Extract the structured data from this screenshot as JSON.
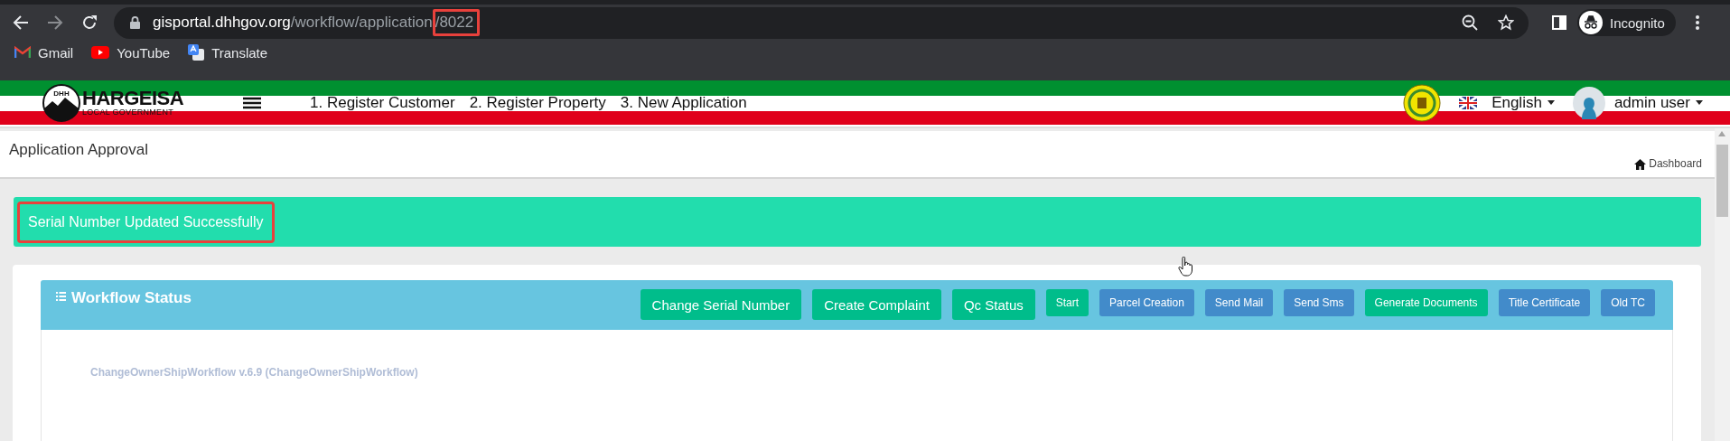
{
  "browser": {
    "url": [
      {
        "text": "gisportal.dhhgov.org",
        "kind": "host",
        "highlighted": false
      },
      {
        "text": "/workflow/application",
        "kind": "path",
        "highlighted": false
      },
      {
        "text": "/8022",
        "kind": "path",
        "highlighted": true
      }
    ],
    "profile": "Incognito",
    "bookmarks": [
      {
        "label": "Gmail",
        "kind": "gmail"
      },
      {
        "label": "YouTube",
        "kind": "youtube"
      },
      {
        "label": "Translate",
        "kind": "translate"
      }
    ]
  },
  "header": {
    "logo_title": "HARGEISA",
    "logo_subtitle": "LOCAL GOVERNMENT",
    "logo_letters": "DHH",
    "nav": [
      "1. Register Customer",
      "2. Register Property",
      "3. New Application"
    ],
    "language": "English",
    "user": "admin user"
  },
  "page": {
    "title": "Application Approval",
    "breadcrumb": "Dashboard"
  },
  "alert": {
    "message": "Serial Number Updated Successfully",
    "highlighted": true
  },
  "workflow": {
    "title": "Workflow Status",
    "buttons": [
      {
        "label": "Change Serial Number",
        "kind": "large",
        "color": "#00bd8b"
      },
      {
        "label": "Create Complaint",
        "kind": "large",
        "color": "#00bd8b"
      },
      {
        "label": "Qc Status",
        "kind": "large",
        "color": "#00bd8b"
      },
      {
        "label": "Start",
        "kind": "small",
        "color": "#00bd8b"
      },
      {
        "label": "Parcel Creation",
        "kind": "small",
        "color": "#428bca"
      },
      {
        "label": "Send Mail",
        "kind": "small",
        "color": "#428bca"
      },
      {
        "label": "Send Sms",
        "kind": "small",
        "color": "#428bca"
      },
      {
        "label": "Generate Documents",
        "kind": "small",
        "color": "#00bd8b"
      },
      {
        "label": "Title Certificate",
        "kind": "small",
        "color": "#428bca"
      },
      {
        "label": "Old TC",
        "kind": "small",
        "color": "#428bca"
      }
    ],
    "name": "ChangeOwnerShipWorkflow v.6.9 (ChangeOwnerShipWorkflow)"
  }
}
